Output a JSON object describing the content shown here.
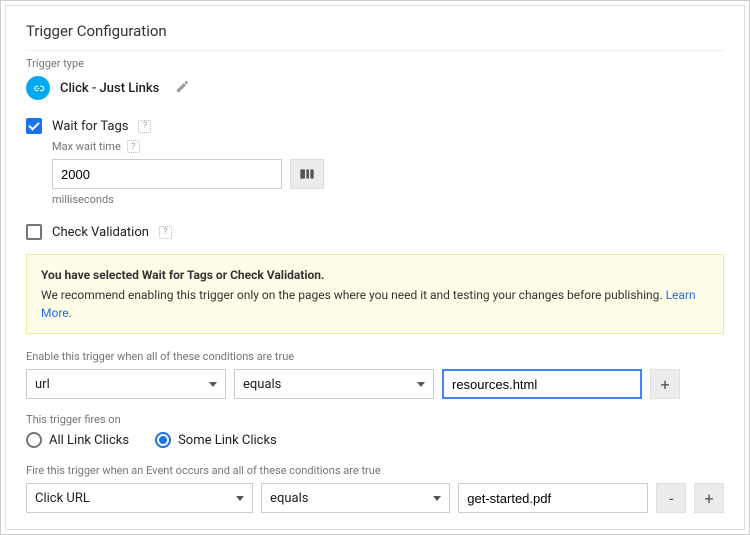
{
  "header": {
    "title": "Trigger Configuration"
  },
  "triggerType": {
    "label": "Trigger type",
    "name": "Click - Just Links"
  },
  "waitForTags": {
    "label": "Wait for Tags",
    "checked": true,
    "maxWaitLabel": "Max wait time",
    "value": "2000",
    "units": "milliseconds"
  },
  "checkValidation": {
    "label": "Check Validation",
    "checked": false
  },
  "notice": {
    "bold": "You have selected Wait for Tags or Check Validation.",
    "body": "We recommend enabling this trigger only on the pages where you need it and testing your changes before publishing. ",
    "link": "Learn More"
  },
  "enableHeading": "Enable this trigger when all of these conditions are true",
  "enableRow": {
    "variable": "url",
    "operator": "equals",
    "value": "resources.html"
  },
  "firesOnLabel": "This trigger fires on",
  "radios": {
    "all": "All Link Clicks",
    "some": "Some Link Clicks",
    "selected": "some"
  },
  "fireHeading": "Fire this trigger when an Event occurs and all of these conditions are true",
  "fireRow": {
    "variable": "Click URL",
    "operator": "equals",
    "value": "get-started.pdf"
  },
  "symbols": {
    "plus": "+",
    "minus": "-",
    "help": "?",
    "dot": "."
  }
}
